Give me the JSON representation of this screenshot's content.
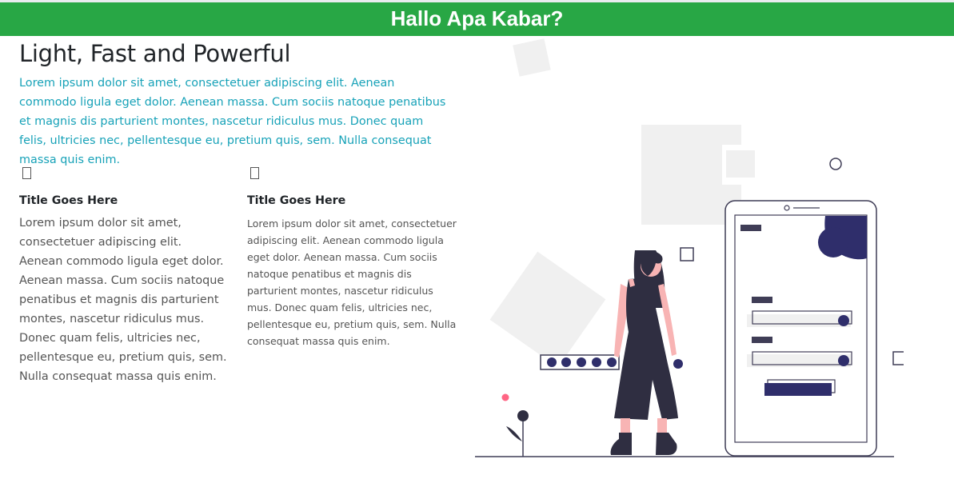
{
  "banner": {
    "title": "Hallo Apa Kabar?"
  },
  "hero": {
    "headline": "Light, Fast and Powerful",
    "lead": "Lorem ipsum dolor sit amet, consectetuer adipiscing elit. Aenean commodo ligula eget dolor. Aenean massa. Cum sociis natoque penatibus et magnis dis parturient montes, nascetur ridiculus mus. Donec quam felis, ultricies nec, pellentesque eu, pretium quis, sem. Nulla consequat massa quis enim."
  },
  "features": [
    {
      "icon": "missing-glyph-icon",
      "title": "Title Goes Here",
      "text": "Lorem ipsum dolor sit amet, consectetuer adipiscing elit. Aenean commodo ligula eget dolor. Aenean massa. Cum sociis natoque penatibus et magnis dis parturient montes, nascetur ridiculus mus. Donec quam felis, ultricies nec, pellentesque eu, pretium quis, sem. Nulla consequat massa quis enim."
    },
    {
      "icon": "missing-glyph-icon",
      "title": "Title Goes Here",
      "text": "Lorem ipsum dolor sit amet, consectetuer adipiscing elit. Aenean commodo ligula eget dolor. Aenean massa. Cum sociis natoque penatibus et magnis dis parturient montes, nascetur ridiculus mus. Donec quam felis, ultricies nec, pellentesque eu, pretium quis, sem. Nulla consequat massa quis enim."
    }
  ],
  "illustration": {
    "subject": "woman-with-smartphone-login-illustration",
    "colors": {
      "banner": "#28a745",
      "lead_text": "#17a2b8",
      "accent_navy": "#2f2e6b",
      "dark": "#2f2e41",
      "skin": "#f8b4b4",
      "light_gray": "#f0f0f0",
      "pink_dot": "#ff6584"
    }
  }
}
